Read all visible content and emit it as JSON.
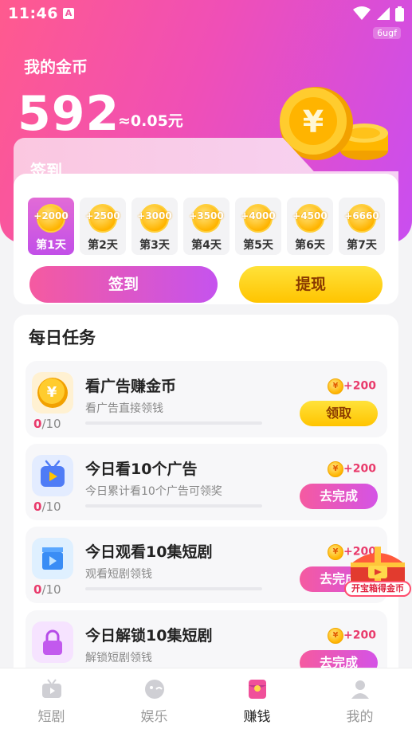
{
  "status_bar": {
    "time": "11:46",
    "tag": "6ugf"
  },
  "header": {
    "title": "我的金币",
    "coins": "592",
    "yuan_equiv": "≈0.05元"
  },
  "checkin": {
    "label": "签到",
    "days": [
      {
        "reward": "+2000",
        "label": "第1天"
      },
      {
        "reward": "+2500",
        "label": "第2天"
      },
      {
        "reward": "+3000",
        "label": "第3天"
      },
      {
        "reward": "+3500",
        "label": "第4天"
      },
      {
        "reward": "+4000",
        "label": "第5天"
      },
      {
        "reward": "+4500",
        "label": "第6天"
      },
      {
        "reward": "+6660",
        "label": "第7天"
      }
    ],
    "sign_button": "签到",
    "withdraw_button": "提现"
  },
  "tasks": {
    "title": "每日任务",
    "items": [
      {
        "name": "看广告赚金币",
        "desc": "看广告直接领钱",
        "progress_done": "0",
        "progress_total": "/10",
        "reward": "+200",
        "button": "领取"
      },
      {
        "name": "今日看10个广告",
        "desc": "今日累计看10个广告可领奖",
        "progress_done": "0",
        "progress_total": "/10",
        "reward": "+200",
        "button": "去完成"
      },
      {
        "name": "今日观看10集短剧",
        "desc": "观看短剧领钱",
        "progress_done": "0",
        "progress_total": "/10",
        "reward": "+200",
        "button": "去完成"
      },
      {
        "name": "今日解锁10集短剧",
        "desc": "解锁短剧领钱",
        "progress_done": "0",
        "progress_total": "/10",
        "reward": "+200",
        "button": "去完成"
      }
    ],
    "coin_symbol": "¥"
  },
  "chest": {
    "label": "开宝箱得金币"
  },
  "bottom_nav": [
    {
      "label": "短剧"
    },
    {
      "label": "娱乐"
    },
    {
      "label": "赚钱"
    },
    {
      "label": "我的"
    }
  ],
  "colors": {
    "accent_pink": "#f55aa0",
    "accent_purple": "#c553ee",
    "gold": "#ffc400",
    "reward_red": "#e93a6b"
  }
}
